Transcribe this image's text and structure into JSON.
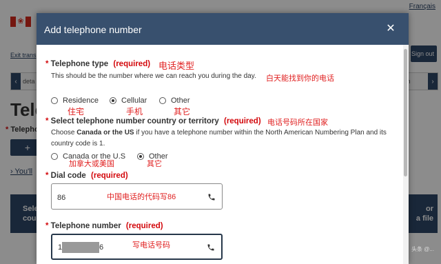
{
  "background": {
    "language_link": "Français",
    "exit_link": "Exit trans",
    "sign_out": "Sign out",
    "step_left": "deta",
    "step_right": "tion",
    "page_title": "Tele",
    "telephone_label": "Telepho",
    "plus_button": "+",
    "youll_link": "You'll",
    "table_col1_line1": "Sele",
    "table_col1_line2": "coun",
    "table_col2_line1": "or",
    "table_col2_line2": "a file",
    "watermark": "头条 @..."
  },
  "modal": {
    "title": "Add telephone number",
    "close_icon": "close-icon",
    "phone_icon": "phone-icon",
    "telephone_type": {
      "label": "Telephone type",
      "required": "(required)",
      "hint": "This should be the number where we can reach you during the day.",
      "options": [
        {
          "label": "Residence",
          "selected": false
        },
        {
          "label": "Cellular",
          "selected": true
        },
        {
          "label": "Other",
          "selected": false
        }
      ],
      "note_title": "电话类型",
      "note_hint": "白天能找到你的电话",
      "note_options": [
        "住宅",
        "手机",
        "其它"
      ]
    },
    "country": {
      "label": "Select telephone number country or territory",
      "required": "(required)",
      "hint_pre": "Choose ",
      "hint_bold1": "Canada or the US",
      "hint_mid": " if you have a telephone number within the North American Numbering Plan and its country code is 1.",
      "options": [
        {
          "label": "Canada or the U.S",
          "selected": false
        },
        {
          "label": "Other",
          "selected": true
        }
      ],
      "note_title": "电话号码所在国家",
      "note_options": [
        "加拿大或美国",
        "其它"
      ]
    },
    "dial_code": {
      "label": "Dial code",
      "required": "(required)",
      "value": "86",
      "note": "中国电话的代码写86"
    },
    "telephone_number": {
      "label": "Telephone number",
      "required": "(required)",
      "value_start": "1",
      "value_end": "6",
      "note": "写电话号码"
    }
  },
  "colors": {
    "header": "#38506e",
    "required": "#d3080c",
    "annotation": "#e02020",
    "flag_red": "#d52b1e"
  }
}
